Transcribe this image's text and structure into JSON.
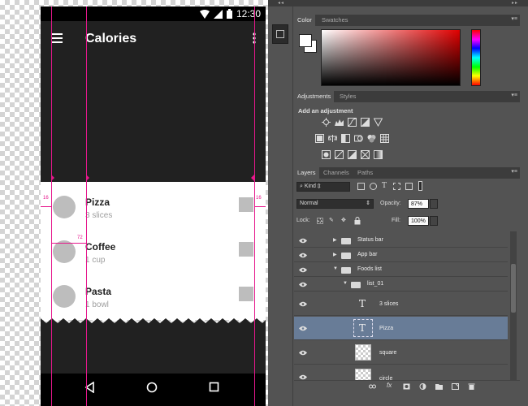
{
  "phone": {
    "status_time": "12:30",
    "app_title": "Calories",
    "foods": [
      {
        "name": "Pizza",
        "detail": "3 slices"
      },
      {
        "name": "Coffee",
        "detail": "1 cup"
      },
      {
        "name": "Pasta",
        "detail": "1 bowl"
      }
    ],
    "guides": {
      "left_margin": "16",
      "right_margin": "16",
      "text_inset": "72"
    },
    "guide_color": "#e6178c"
  },
  "photoshop": {
    "color_panel": {
      "tabs": [
        "Color",
        "Swatches"
      ],
      "active_tab": 0,
      "foreground": "#ffffff",
      "background": "#ffffff"
    },
    "adjustments_panel": {
      "tabs": [
        "Adjustments",
        "Styles"
      ],
      "active_tab": 0,
      "heading": "Add an adjustment"
    },
    "layers_panel": {
      "tabs": [
        "Layers",
        "Channels",
        "Paths"
      ],
      "active_tab": 0,
      "filter_kind": "Kind",
      "blend_mode": "Normal",
      "opacity_label": "Opacity:",
      "opacity": "87%",
      "lock_label": "Lock:",
      "fill_label": "Fill:",
      "fill": "100%",
      "layers": [
        {
          "name": "Status bar",
          "type": "group",
          "state": "collapsed",
          "selected": false
        },
        {
          "name": "App bar",
          "type": "group",
          "state": "collapsed",
          "selected": false
        },
        {
          "name": "Foods list",
          "type": "group",
          "state": "expanded",
          "selected": false
        },
        {
          "name": "list_01",
          "type": "group",
          "state": "expanded",
          "selected": false
        },
        {
          "name": "3 slices",
          "type": "text",
          "selected": false
        },
        {
          "name": "Pizza",
          "type": "text",
          "selected": true
        },
        {
          "name": "square",
          "type": "shape",
          "selected": false
        },
        {
          "name": "circle",
          "type": "shape",
          "selected": false
        }
      ]
    }
  }
}
